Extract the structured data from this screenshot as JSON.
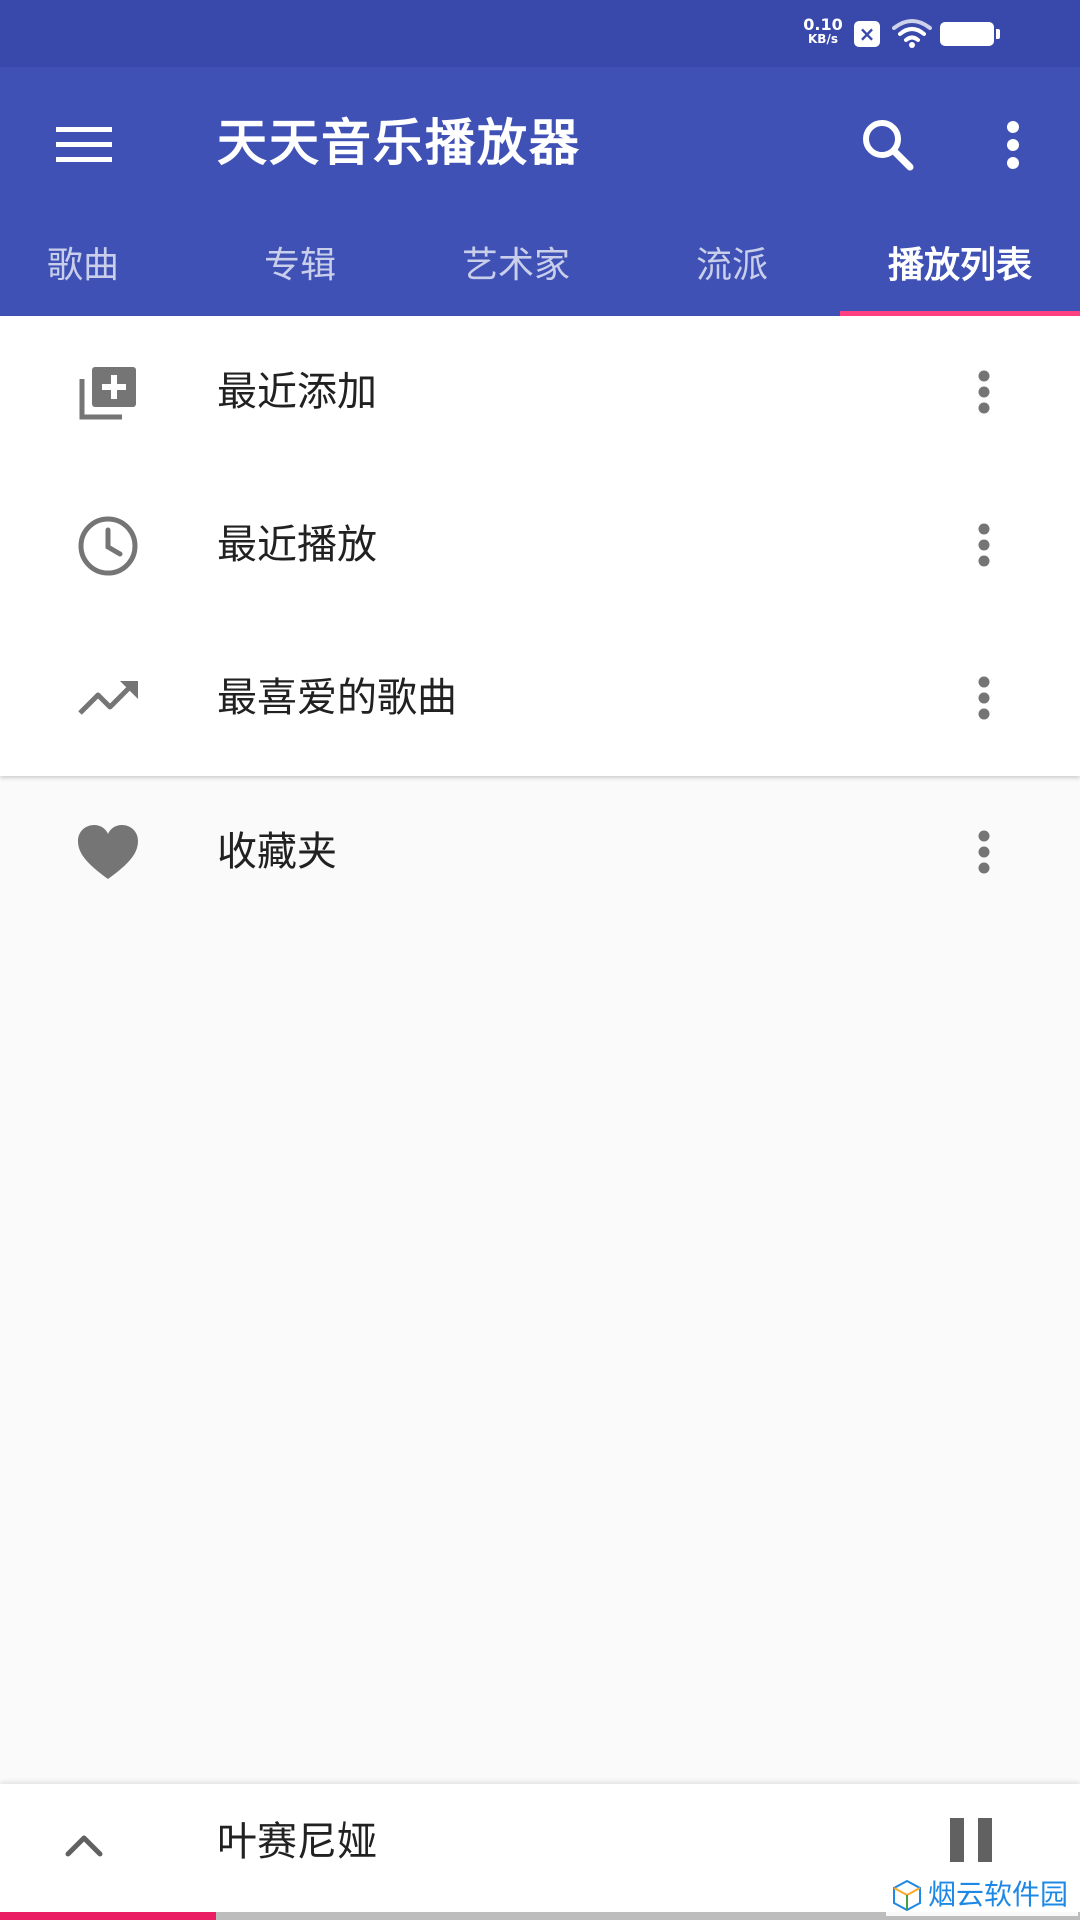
{
  "status_bar": {
    "net_speed_value": "0.10",
    "net_speed_unit": "KB/s"
  },
  "app_bar": {
    "title": "天天音乐播放器",
    "icons": {
      "menu": "menu-icon",
      "search": "search-icon",
      "more": "more-vert-icon"
    },
    "background_color": "#3f51b5",
    "status_color": "#3949ab"
  },
  "tabs": [
    {
      "label": "歌曲"
    },
    {
      "label": "专辑"
    },
    {
      "label": "艺术家"
    },
    {
      "label": "流派"
    },
    {
      "label": "播放列表"
    }
  ],
  "active_tab": "播放列表",
  "accent_color": "#ff4081",
  "playlists": [
    {
      "label": "最近添加",
      "icon": "library-add-icon"
    },
    {
      "label": "最近播放",
      "icon": "clock-icon"
    },
    {
      "label": "最喜爱的歌曲",
      "icon": "trending-up-icon"
    },
    {
      "label": "收藏夹",
      "icon": "heart-icon"
    }
  ],
  "mini_player": {
    "song_title": "叶赛尼娅",
    "expand_icon": "chevron-up-icon",
    "pause_icon": "pause-icon",
    "progress_fraction": 0.2
  },
  "watermark": {
    "text": "烟云软件园"
  }
}
